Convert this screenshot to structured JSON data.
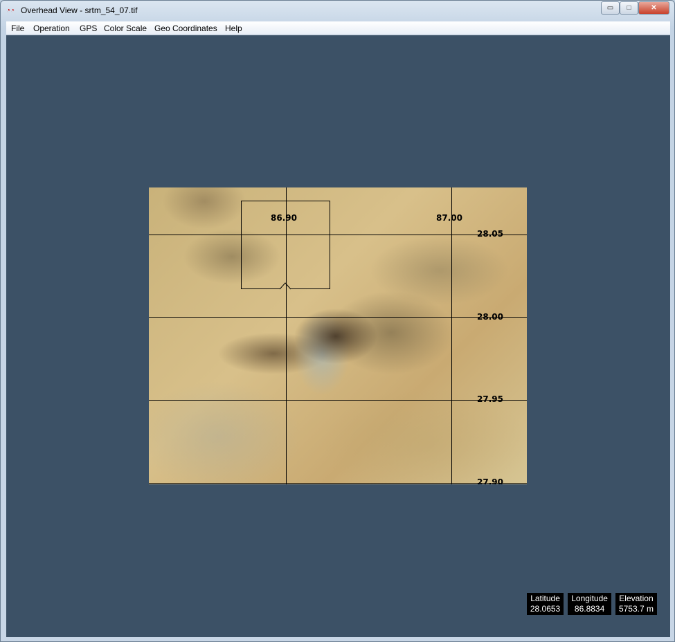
{
  "window": {
    "title": "Overhead View - srtm_54_07.tif",
    "icon": "app-icon",
    "controls": {
      "minimize": "▭",
      "maximize": "□",
      "close": "✕"
    }
  },
  "menu": [
    "File",
    "Operation",
    "GPS",
    "Color Scale",
    "Geo Coordinates",
    "Help"
  ],
  "map": {
    "longitude_labels": [
      "86.90",
      "87.00"
    ],
    "latitude_labels": [
      "28.05",
      "28.00",
      "27.95",
      "27.90"
    ]
  },
  "readouts": [
    {
      "label": "Latitude",
      "value": "28.0653"
    },
    {
      "label": "Longitude",
      "value": "86.8834"
    },
    {
      "label": "Elevation",
      "value": "5753.7 m"
    }
  ],
  "colors": {
    "background": "#3c5166",
    "readout_bg": "#000000"
  }
}
